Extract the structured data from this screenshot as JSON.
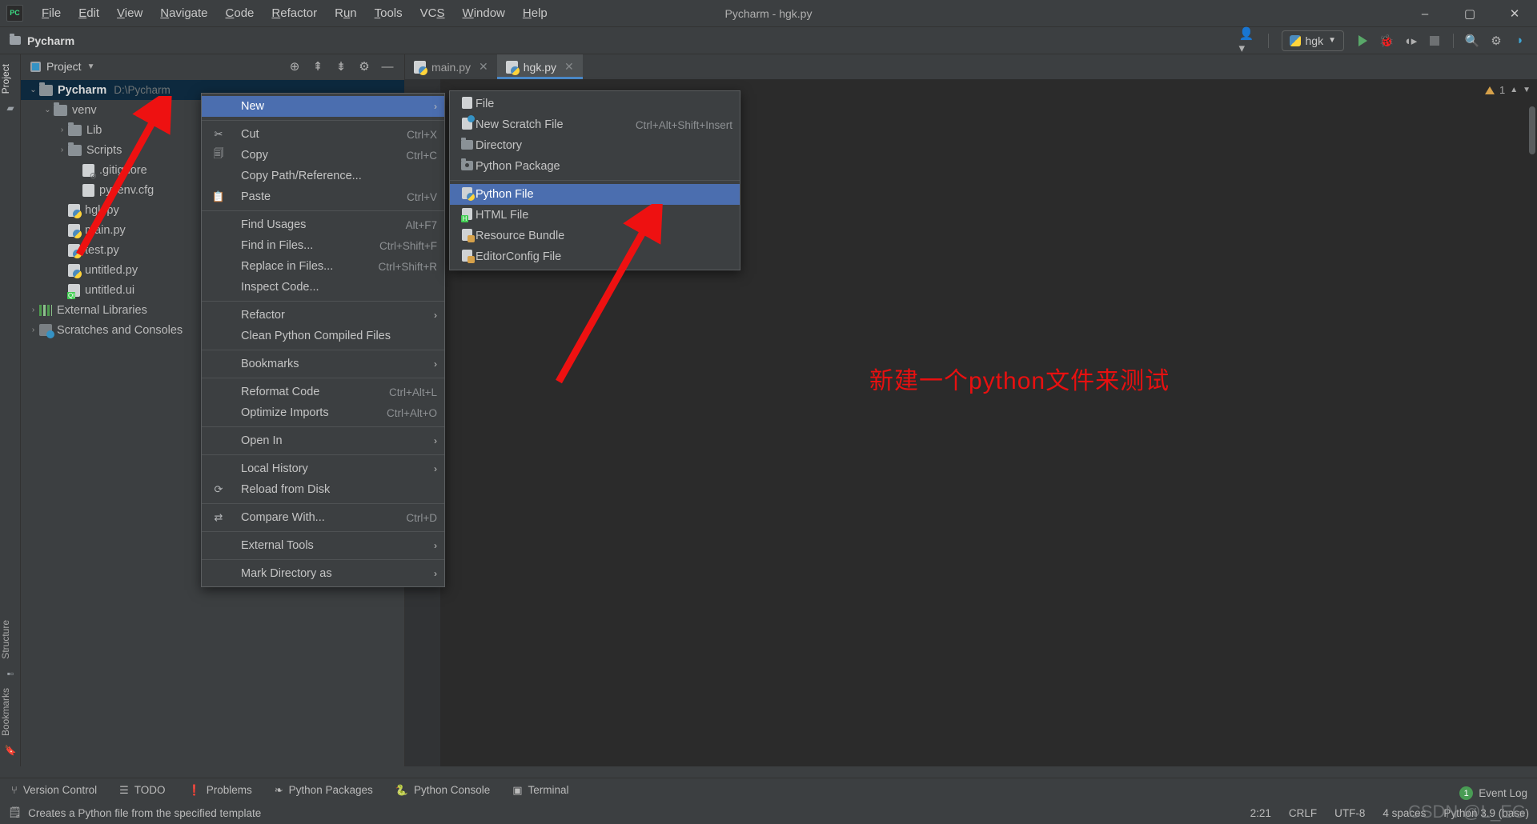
{
  "window": {
    "title": "Pycharm - hgk.py",
    "minimize": "–",
    "maximize": "▢",
    "close": "✕"
  },
  "menubar": {
    "items": [
      "File",
      "Edit",
      "View",
      "Navigate",
      "Code",
      "Refactor",
      "Run",
      "Tools",
      "VCS",
      "Window",
      "Help"
    ]
  },
  "projectbar": {
    "name": "Pycharm",
    "run_config": "hgk",
    "icons": [
      "user-icon",
      "run-icon",
      "debug-icon",
      "coverage-icon",
      "stop-icon",
      "search-icon",
      "settings-icon",
      "ai-icon"
    ]
  },
  "left_strip": {
    "top": [
      "Project"
    ],
    "bottom": [
      "Structure",
      "Bookmarks"
    ]
  },
  "project_panel": {
    "header": "Project",
    "tree": [
      {
        "indent": 0,
        "arrow": "⌄",
        "icon": "folder-icon",
        "label": "Pycharm",
        "path": "D:\\Pycharm",
        "bold": true,
        "selected": true
      },
      {
        "indent": 1,
        "arrow": "⌄",
        "icon": "folder-icon",
        "label": "venv",
        "path": "",
        "bold": false,
        "selected": false
      },
      {
        "indent": 2,
        "arrow": "›",
        "icon": "folder-icon",
        "label": "Lib",
        "path": "",
        "bold": false,
        "selected": false
      },
      {
        "indent": 2,
        "arrow": "›",
        "icon": "folder-icon",
        "label": "Scripts",
        "path": "",
        "bold": false,
        "selected": false
      },
      {
        "indent": 3,
        "arrow": "",
        "icon": "gitignore-icon",
        "label": ".gitignore",
        "path": "",
        "bold": false,
        "selected": false
      },
      {
        "indent": 3,
        "arrow": "",
        "icon": "cfg-file-icon",
        "label": "pyvenv.cfg",
        "path": "",
        "bold": false,
        "selected": false
      },
      {
        "indent": 2,
        "arrow": "",
        "icon": "python-file-icon",
        "label": "hgk.py",
        "path": "",
        "bold": false,
        "selected": false
      },
      {
        "indent": 2,
        "arrow": "",
        "icon": "python-file-icon",
        "label": "main.py",
        "path": "",
        "bold": false,
        "selected": false
      },
      {
        "indent": 2,
        "arrow": "",
        "icon": "python-file-icon",
        "label": "test.py",
        "path": "",
        "bold": false,
        "selected": false
      },
      {
        "indent": 2,
        "arrow": "",
        "icon": "python-file-icon",
        "label": "untitled.py",
        "path": "",
        "bold": false,
        "selected": false
      },
      {
        "indent": 2,
        "arrow": "",
        "icon": "qt-ui-file-icon",
        "label": "untitled.ui",
        "path": "",
        "bold": false,
        "selected": false
      },
      {
        "indent": 0,
        "arrow": "›",
        "icon": "libraries-icon",
        "label": "External Libraries",
        "path": "",
        "bold": false,
        "selected": false
      },
      {
        "indent": 0,
        "arrow": "›",
        "icon": "scratches-icon",
        "label": "Scratches and Consoles",
        "path": "",
        "bold": false,
        "selected": false
      }
    ]
  },
  "editor": {
    "tabs": [
      {
        "label": "main.py",
        "active": false
      },
      {
        "label": "hgk.py",
        "active": true
      }
    ],
    "warning_count": "1",
    "annotation": "新建一个python文件来测试"
  },
  "context_menu": {
    "items": [
      {
        "type": "item",
        "label": "New",
        "key": "",
        "icon": "",
        "submenu": true,
        "highlight": true
      },
      {
        "type": "sep"
      },
      {
        "type": "item",
        "label": "Cut",
        "key": "Ctrl+X",
        "icon": "scissors-icon",
        "submenu": false,
        "highlight": false
      },
      {
        "type": "item",
        "label": "Copy",
        "key": "Ctrl+C",
        "icon": "copy-icon",
        "submenu": false,
        "highlight": false
      },
      {
        "type": "item",
        "label": "Copy Path/Reference...",
        "key": "",
        "icon": "",
        "submenu": false,
        "highlight": false
      },
      {
        "type": "item",
        "label": "Paste",
        "key": "Ctrl+V",
        "icon": "clipboard-icon",
        "submenu": false,
        "highlight": false
      },
      {
        "type": "sep"
      },
      {
        "type": "item",
        "label": "Find Usages",
        "key": "Alt+F7",
        "icon": "",
        "submenu": false,
        "highlight": false
      },
      {
        "type": "item",
        "label": "Find in Files...",
        "key": "Ctrl+Shift+F",
        "icon": "",
        "submenu": false,
        "highlight": false
      },
      {
        "type": "item",
        "label": "Replace in Files...",
        "key": "Ctrl+Shift+R",
        "icon": "",
        "submenu": false,
        "highlight": false
      },
      {
        "type": "item",
        "label": "Inspect Code...",
        "key": "",
        "icon": "",
        "submenu": false,
        "highlight": false
      },
      {
        "type": "sep"
      },
      {
        "type": "item",
        "label": "Refactor",
        "key": "",
        "icon": "",
        "submenu": true,
        "highlight": false
      },
      {
        "type": "item",
        "label": "Clean Python Compiled Files",
        "key": "",
        "icon": "",
        "submenu": false,
        "highlight": false
      },
      {
        "type": "sep"
      },
      {
        "type": "item",
        "label": "Bookmarks",
        "key": "",
        "icon": "",
        "submenu": true,
        "highlight": false
      },
      {
        "type": "sep"
      },
      {
        "type": "item",
        "label": "Reformat Code",
        "key": "Ctrl+Alt+L",
        "icon": "",
        "submenu": false,
        "highlight": false
      },
      {
        "type": "item",
        "label": "Optimize Imports",
        "key": "Ctrl+Alt+O",
        "icon": "",
        "submenu": false,
        "highlight": false
      },
      {
        "type": "sep"
      },
      {
        "type": "item",
        "label": "Open In",
        "key": "",
        "icon": "",
        "submenu": true,
        "highlight": false
      },
      {
        "type": "sep"
      },
      {
        "type": "item",
        "label": "Local History",
        "key": "",
        "icon": "",
        "submenu": true,
        "highlight": false
      },
      {
        "type": "item",
        "label": "Reload from Disk",
        "key": "",
        "icon": "reload-icon",
        "submenu": false,
        "highlight": false
      },
      {
        "type": "sep"
      },
      {
        "type": "item",
        "label": "Compare With...",
        "key": "Ctrl+D",
        "icon": "compare-icon",
        "submenu": false,
        "highlight": false
      },
      {
        "type": "sep"
      },
      {
        "type": "item",
        "label": "External Tools",
        "key": "",
        "icon": "",
        "submenu": true,
        "highlight": false
      },
      {
        "type": "sep"
      },
      {
        "type": "item",
        "label": "Mark Directory as",
        "key": "",
        "icon": "",
        "submenu": true,
        "highlight": false
      }
    ]
  },
  "new_submenu": {
    "items": [
      {
        "type": "item",
        "label": "File",
        "key": "",
        "icon": "file-icon",
        "highlight": false
      },
      {
        "type": "item",
        "label": "New Scratch File",
        "key": "Ctrl+Alt+Shift+Insert",
        "icon": "scratch-file-icon",
        "highlight": false
      },
      {
        "type": "item",
        "label": "Directory",
        "key": "",
        "icon": "directory-icon",
        "highlight": false
      },
      {
        "type": "item",
        "label": "Python Package",
        "key": "",
        "icon": "python-package-icon",
        "highlight": false
      },
      {
        "type": "sep"
      },
      {
        "type": "item",
        "label": "Python File",
        "key": "",
        "icon": "python-file-icon",
        "highlight": true
      },
      {
        "type": "item",
        "label": "HTML File",
        "key": "",
        "icon": "html-file-icon",
        "highlight": false
      },
      {
        "type": "item",
        "label": "Resource Bundle",
        "key": "",
        "icon": "resource-bundle-icon",
        "highlight": false
      },
      {
        "type": "item",
        "label": "EditorConfig File",
        "key": "",
        "icon": "editorconfig-icon",
        "highlight": false
      }
    ]
  },
  "bottom_bar": {
    "items": [
      {
        "label": "Version Control",
        "icon": "branch-icon"
      },
      {
        "label": "TODO",
        "icon": "list-icon"
      },
      {
        "label": "Problems",
        "icon": "warning-icon"
      },
      {
        "label": "Python Packages",
        "icon": "packages-icon"
      },
      {
        "label": "Python Console",
        "icon": "python-icon"
      },
      {
        "label": "Terminal",
        "icon": "terminal-icon"
      }
    ],
    "event_log": {
      "label": "Event Log",
      "count": "1"
    }
  },
  "status_bar": {
    "message": "Creates a Python file from the specified template",
    "right": [
      "2:21",
      "CRLF",
      "UTF-8",
      "4 spaces",
      "Python 3.9 (base)"
    ]
  },
  "watermark": "CSDN @L_EG"
}
